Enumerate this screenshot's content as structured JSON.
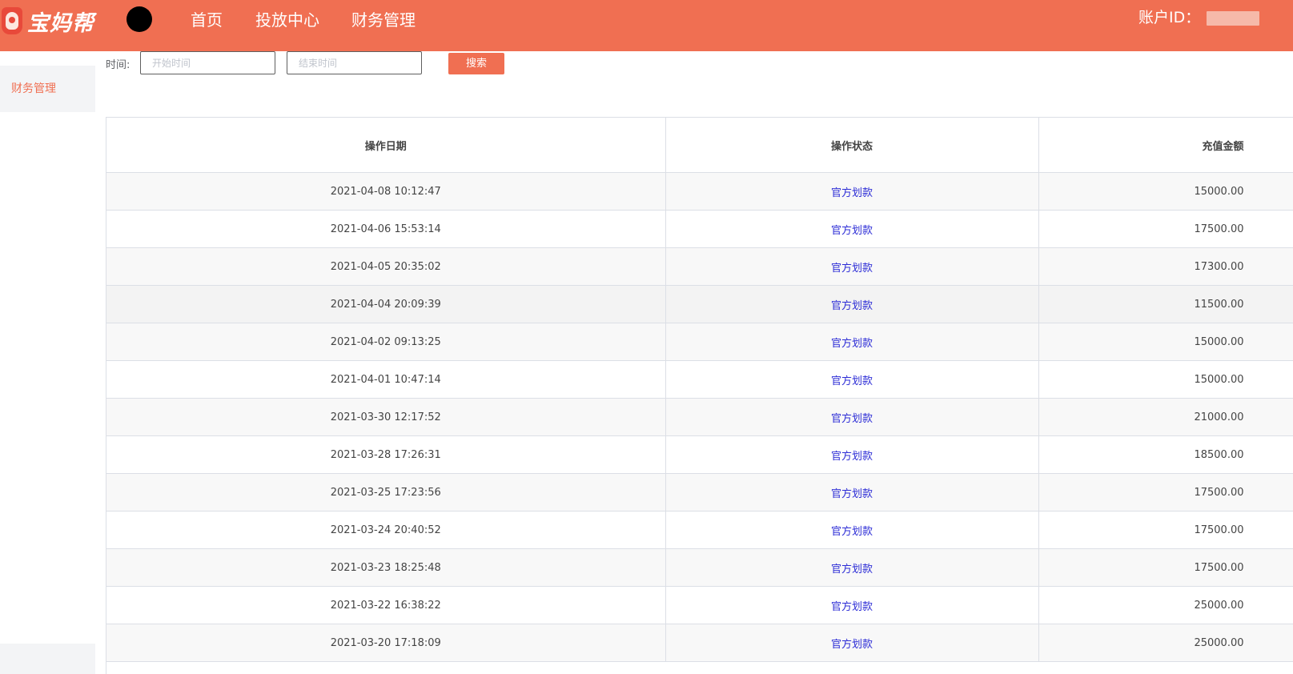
{
  "header": {
    "logo_text": "宝妈帮",
    "nav": [
      {
        "label": "首页"
      },
      {
        "label": "投放中心"
      },
      {
        "label": "财务管理"
      }
    ],
    "account_label": "账户ID："
  },
  "sidebar": {
    "items": [
      {
        "label": "财务管理",
        "active": true
      }
    ]
  },
  "filter": {
    "label": "时间:",
    "start_placeholder": "开始时间",
    "end_placeholder": "结束时间",
    "search_label": "搜索"
  },
  "table": {
    "columns": [
      "操作日期",
      "操作状态",
      "充值金额"
    ],
    "rows": [
      {
        "date": "2021-04-08 10:12:47",
        "status": "官方划款",
        "amount": "15000.00"
      },
      {
        "date": "2021-04-06 15:53:14",
        "status": "官方划款",
        "amount": "17500.00"
      },
      {
        "date": "2021-04-05 20:35:02",
        "status": "官方划款",
        "amount": "17300.00"
      },
      {
        "date": "2021-04-04 20:09:39",
        "status": "官方划款",
        "amount": "11500.00"
      },
      {
        "date": "2021-04-02 09:13:25",
        "status": "官方划款",
        "amount": "15000.00"
      },
      {
        "date": "2021-04-01 10:47:14",
        "status": "官方划款",
        "amount": "15000.00"
      },
      {
        "date": "2021-03-30 12:17:52",
        "status": "官方划款",
        "amount": "21000.00"
      },
      {
        "date": "2021-03-28 17:26:31",
        "status": "官方划款",
        "amount": "18500.00"
      },
      {
        "date": "2021-03-25 17:23:56",
        "status": "官方划款",
        "amount": "17500.00"
      },
      {
        "date": "2021-03-24 20:40:52",
        "status": "官方划款",
        "amount": "17500.00"
      },
      {
        "date": "2021-03-23 18:25:48",
        "status": "官方划款",
        "amount": "17500.00"
      },
      {
        "date": "2021-03-22 16:38:22",
        "status": "官方划款",
        "amount": "25000.00"
      },
      {
        "date": "2021-03-20 17:18:09",
        "status": "官方划款",
        "amount": "25000.00"
      }
    ]
  },
  "colors": {
    "accent": "#f06f52",
    "status_link": "#2d2dd6"
  }
}
